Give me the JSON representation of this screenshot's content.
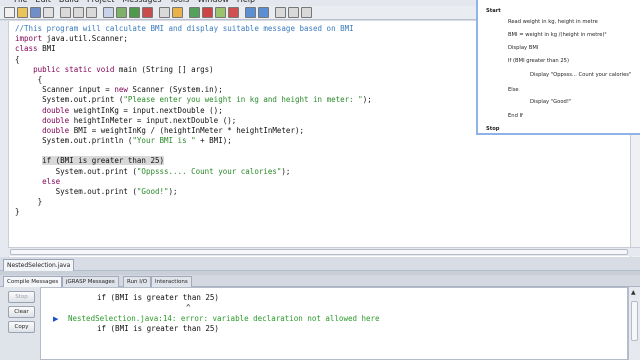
{
  "menu": {
    "items": [
      "File",
      "Edit",
      "Build",
      "Project",
      "Messages",
      "Tools",
      "Window",
      "Help"
    ]
  },
  "editor": {
    "lines": [
      {
        "parts": [
          {
            "t": "//This program will calculate BMI and display suitable message based on BMI",
            "c": "cm"
          }
        ]
      },
      {
        "parts": [
          {
            "t": "import",
            "c": "kw"
          },
          {
            "t": " java.util.Scanner;"
          }
        ]
      },
      {
        "parts": [
          {
            "t": "class",
            "c": "kw"
          },
          {
            "t": " BMI"
          }
        ]
      },
      {
        "parts": [
          {
            "t": "{"
          }
        ]
      },
      {
        "parts": [
          {
            "t": "    "
          },
          {
            "t": "public static void",
            "c": "kw"
          },
          {
            "t": " main (String [] args)"
          }
        ]
      },
      {
        "parts": [
          {
            "t": "     {"
          }
        ]
      },
      {
        "parts": [
          {
            "t": "      Scanner input = "
          },
          {
            "t": "new",
            "c": "kw"
          },
          {
            "t": " Scanner (System.in);"
          }
        ]
      },
      {
        "parts": [
          {
            "t": "      System.out.print ("
          },
          {
            "t": "\"Please enter you weight in kg and height in meter: \"",
            "c": "st"
          },
          {
            "t": ");"
          }
        ]
      },
      {
        "parts": [
          {
            "t": "      "
          },
          {
            "t": "double",
            "c": "kw"
          },
          {
            "t": " weightInKg = input.nextDouble ();"
          }
        ]
      },
      {
        "parts": [
          {
            "t": "      "
          },
          {
            "t": "double",
            "c": "kw"
          },
          {
            "t": " heightInMeter = input.nextDouble ();"
          }
        ]
      },
      {
        "parts": [
          {
            "t": "      "
          },
          {
            "t": "double",
            "c": "kw"
          },
          {
            "t": " BMI = weightInKg / (heightInMeter * heightInMeter);"
          }
        ]
      },
      {
        "parts": [
          {
            "t": "      System.out.println ("
          },
          {
            "t": "\"Your BMI is \"",
            "c": "st"
          },
          {
            "t": " + BMI);"
          }
        ]
      },
      {
        "parts": [
          {
            "t": ""
          }
        ]
      },
      {
        "parts": [
          {
            "t": "      "
          },
          {
            "t": "if (BMI is greater than 25)",
            "c": "hl"
          }
        ]
      },
      {
        "parts": [
          {
            "t": "         System.out.print ("
          },
          {
            "t": "\"Oppsss.... Count your calories\"",
            "c": "st"
          },
          {
            "t": ");"
          }
        ]
      },
      {
        "parts": [
          {
            "t": "      "
          },
          {
            "t": "else",
            "c": "kw"
          }
        ]
      },
      {
        "parts": [
          {
            "t": "         System.out.print ("
          },
          {
            "t": "\"Good!\"",
            "c": "st"
          },
          {
            "t": ");"
          }
        ]
      },
      {
        "parts": [
          {
            "t": "     }"
          }
        ]
      },
      {
        "parts": [
          {
            "t": "}"
          }
        ]
      }
    ]
  },
  "pseudocode": {
    "lines": [
      {
        "text": "Start",
        "bold": true,
        "indent": 0
      },
      {
        "text": "Read weight in kg, height in metre",
        "bold": false,
        "indent": 1,
        "lead": "Read"
      },
      {
        "text": "BMI = weight in kg /(height in metre)²",
        "bold": false,
        "indent": 1
      },
      {
        "text": "Display BMI",
        "bold": false,
        "indent": 1
      },
      {
        "text": "If (BMI greater than 25)",
        "bold": false,
        "indent": 1
      },
      {
        "text": "Display \"Oppsss... Count your calories\"",
        "bold": false,
        "indent": 2
      },
      {
        "text": "Else",
        "bold": false,
        "indent": 1
      },
      {
        "text": "Display \"Good!\"",
        "bold": false,
        "indent": 2
      },
      {
        "text": "End If",
        "bold": false,
        "indent": 1
      },
      {
        "text": "Stop",
        "bold": true,
        "indent": 0
      }
    ]
  },
  "file_tab": {
    "label": "NestedSelection.java"
  },
  "bottom_tabs": [
    {
      "label": "Compile Messages",
      "active": true
    },
    {
      "label": "jGRASP Messages",
      "active": false
    },
    {
      "label": "Run I/O",
      "active": false
    },
    {
      "label": "Interactions",
      "active": false
    }
  ],
  "message_buttons": {
    "stop": "Stop",
    "clear": "Clear",
    "copy": "Copy"
  },
  "messages": {
    "line1": "if (BMI is greater than 25)",
    "caret": "^",
    "error": "NestedSelection.java:14: error: variable declaration not allowed here",
    "line3": "if (BMI is greater than 25)"
  },
  "colors": {
    "keyword": "#7f0055",
    "string": "#2a8a2a",
    "comment": "#3a7bbf",
    "error_text": "#2a9a2a"
  }
}
